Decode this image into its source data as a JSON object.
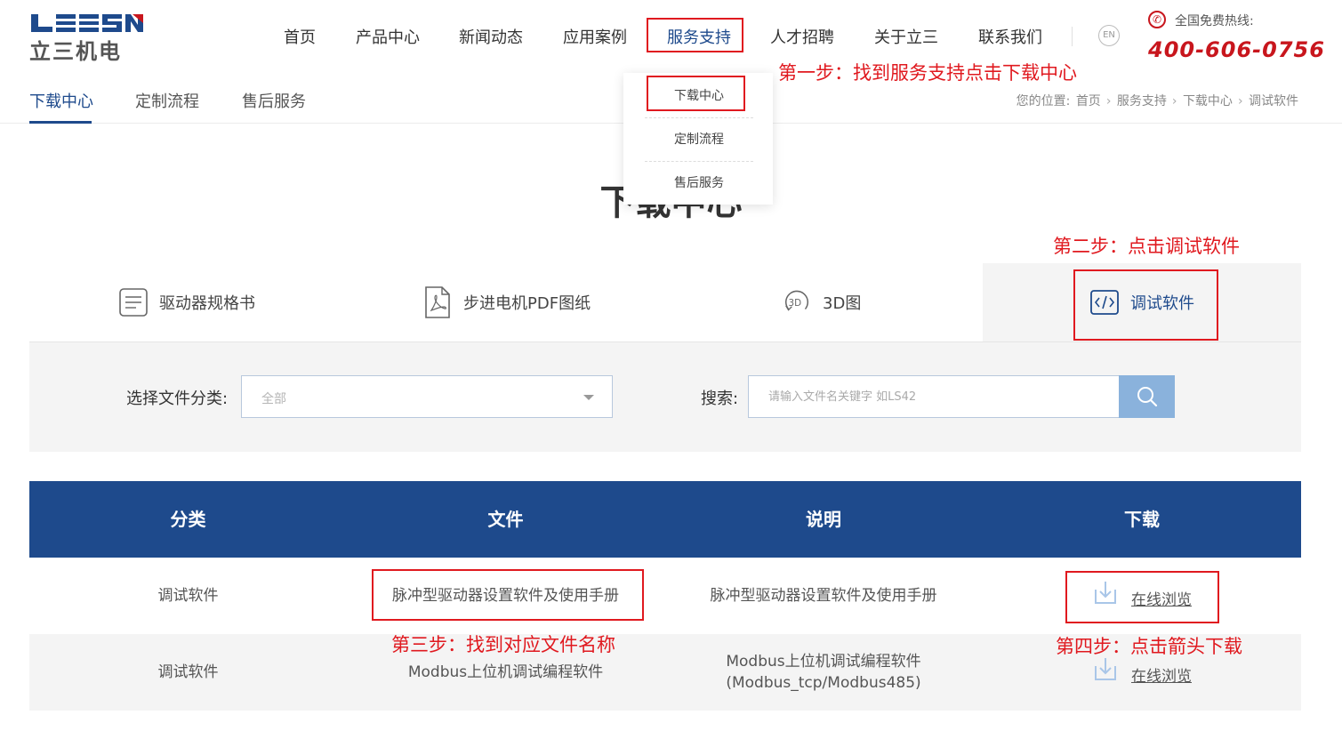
{
  "header": {
    "logo_text_en": "LEESN",
    "logo_text_cn": "立三机电",
    "nav": [
      "首页",
      "产品中心",
      "新闻动态",
      "应用案例",
      "服务支持",
      "人才招聘",
      "关于立三",
      "联系我们"
    ],
    "lang_label": "EN",
    "hotline_label": "全国免费热线:",
    "hotline_number": "400-606-0756"
  },
  "subnav": {
    "items": [
      "下载中心",
      "定制流程",
      "售后服务"
    ],
    "breadcrumb_label": "您的位置:",
    "breadcrumb": [
      "首页",
      "服务支持",
      "下载中心",
      "调试软件"
    ]
  },
  "dropdown": {
    "items": [
      "下载中心",
      "定制流程",
      "售后服务"
    ]
  },
  "page_title": "下载中心",
  "tabs": [
    {
      "label": "驱动器规格书",
      "icon": "document-lines-icon"
    },
    {
      "label": "步进电机PDF图纸",
      "icon": "pdf-file-icon"
    },
    {
      "label": "3D图",
      "icon": "3d-rotate-icon"
    },
    {
      "label": "调试软件",
      "icon": "code-icon"
    }
  ],
  "filter": {
    "category_label": "选择文件分类:",
    "category_value": "全部",
    "search_label": "搜索:",
    "search_placeholder": "请输入文件名关键字 如LS42"
  },
  "table": {
    "headers": [
      "分类",
      "文件",
      "说明",
      "下载"
    ],
    "rows": [
      {
        "category": "调试软件",
        "file": "脉冲型驱动器设置软件及使用手册",
        "desc": "脉冲型驱动器设置软件及使用手册",
        "action": "在线浏览"
      },
      {
        "category": "调试软件",
        "file": "Modbus上位机调试编程软件",
        "desc_line1": "Modbus上位机调试编程软件",
        "desc_line2": "(Modbus_tcp/Modbus485)",
        "action": "在线浏览"
      }
    ]
  },
  "annotations": {
    "step1": "第一步：找到服务支持点击下载中心",
    "step2": "第二步：点击调试软件",
    "step3": "第三步：找到对应文件名称",
    "step4": "第四步：点击箭头下载"
  },
  "colors": {
    "brand_blue": "#1e4a8c",
    "annotation_red": "#e0191f",
    "hotline_red": "#c8161d",
    "search_button": "#8ab2dc"
  }
}
